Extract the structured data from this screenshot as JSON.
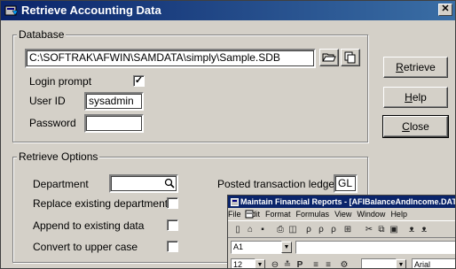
{
  "window": {
    "title": "Retrieve Accounting Data",
    "close_label": "✕"
  },
  "database": {
    "legend": "Database",
    "path_value": "C:\\SOFTRAK\\AFWIN\\SAMDATA\\simply\\Sample.SDB",
    "login_prompt_label": "Login prompt",
    "login_prompt_checked": true,
    "check_mark": "✓",
    "user_id_label": "User ID",
    "user_id_value": "sysadmin",
    "password_label": "Password",
    "password_value": ""
  },
  "buttons": {
    "retrieve_u": "R",
    "retrieve_rest": "etrieve",
    "help_u": "H",
    "help_rest": "elp",
    "close_u": "C",
    "close_rest": "lose"
  },
  "retrieve_options": {
    "legend": "Retrieve Options",
    "department_label": "Department",
    "department_value": "",
    "replace_label": "Replace existing departments",
    "append_label": "Append to existing data",
    "uppercase_label": "Convert to upper case",
    "posted_ledger_label": "Posted transaction ledger",
    "posted_ledger_value": "GL"
  },
  "child_window": {
    "title": "Maintain Financial Reports - [AFIBalanceAndIncome.DAT]",
    "menu": [
      "File",
      "Edit",
      "Format",
      "Formulas",
      "View",
      "Window",
      "Help"
    ],
    "cell_ref": "A1",
    "font_size": "12",
    "font_name": "Arial"
  }
}
